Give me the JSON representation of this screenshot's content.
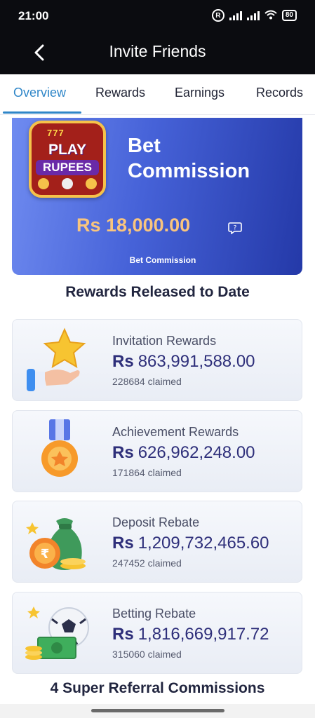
{
  "status": {
    "time": "21:00",
    "r_badge": "R",
    "battery": "80"
  },
  "nav": {
    "title": "Invite Friends"
  },
  "tabs": [
    {
      "label": "Overview",
      "active": true
    },
    {
      "label": "Rewards"
    },
    {
      "label": "Earnings"
    },
    {
      "label": "Records"
    }
  ],
  "bet": {
    "logo_top": "777",
    "logo_play": "PLAY",
    "logo_rupees": "RUPEES",
    "title_line1": "Bet",
    "title_line2": "Commission",
    "amount": "Rs 18,000.00",
    "subtitle": "Bet Commission"
  },
  "released_title": "Rewards Released to Date",
  "rewards": [
    {
      "label": "Invitation Rewards",
      "currency": "Rs",
      "amount": "863,991,588.00",
      "claimed": "228684 claimed",
      "icon": "hand-star-icon"
    },
    {
      "label": "Achievement Rewards",
      "currency": "Rs",
      "amount": "626,962,248.00",
      "claimed": "171864 claimed",
      "icon": "medal-icon"
    },
    {
      "label": "Deposit Rebate",
      "currency": "Rs",
      "amount": "1,209,732,465.60",
      "claimed": "247452 claimed",
      "icon": "money-bag-icon"
    },
    {
      "label": "Betting Rebate",
      "currency": "Rs",
      "amount": "1,816,669,917.72",
      "claimed": "315060 claimed",
      "icon": "football-cash-icon"
    }
  ],
  "footer_title": "4 Super Referral Commissions",
  "colors": {
    "accent": "#2f86c8",
    "amount_gold": "#f9c57e",
    "navy_amount": "#2e2f7a",
    "card_blue": "#4662d8"
  }
}
